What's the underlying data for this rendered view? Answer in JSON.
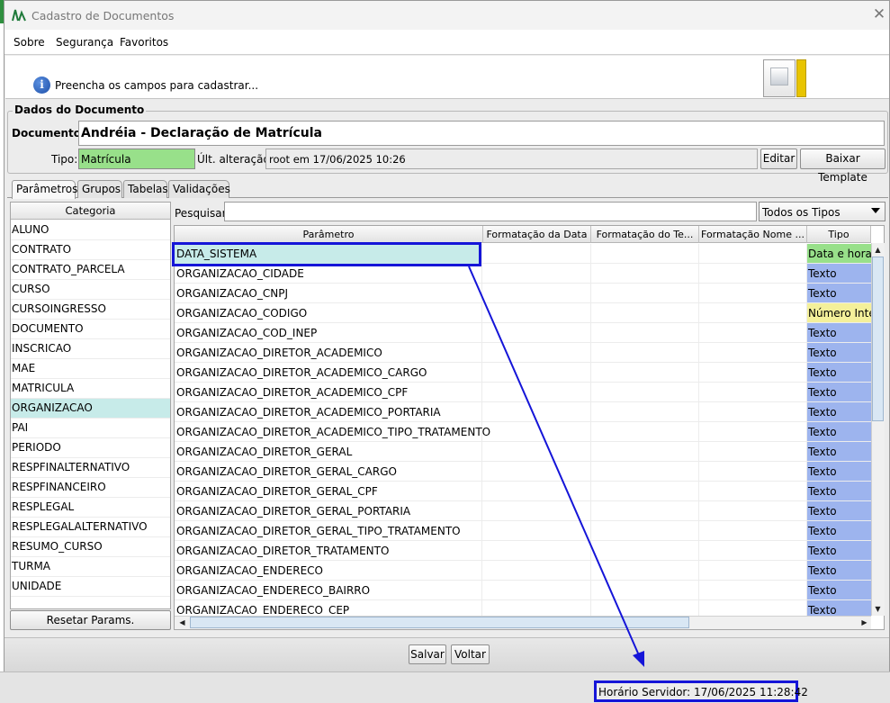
{
  "window": {
    "title": "Cadastro de Documentos",
    "close_glyph": "✕"
  },
  "menu": {
    "items": [
      "Sobre",
      "Segurança",
      "Favoritos"
    ]
  },
  "banner": {
    "message": "Preencha os campos para cadastrar..."
  },
  "document": {
    "group_title": "Dados do Documento",
    "doc_label": "Documento:",
    "doc_value": "Andréia - Declaração de Matrícula",
    "tipo_label": "Tipo:",
    "tipo_value": "Matrícula",
    "ult_label": "Últ. alteração:",
    "ult_value": "root em 17/06/2025 10:26",
    "edit_button": "Editar",
    "download_button": "Baixar Template"
  },
  "tabs": [
    "Parâmetros",
    "Grupos",
    "Tabelas",
    "Validações"
  ],
  "categories": {
    "header": "Categoria",
    "items": [
      "ALUNO",
      "CONTRATO",
      "CONTRATO_PARCELA",
      "CURSO",
      "CURSOINGRESSO",
      "DOCUMENTO",
      "INSCRICAO",
      "MAE",
      "MATRICULA",
      "ORGANIZACAO",
      "PAI",
      "PERIODO",
      "RESPFINALTERNATIVO",
      "RESPFINANCEIRO",
      "RESPLEGAL",
      "RESPLEGALALTERNATIVO",
      "RESUMO_CURSO",
      "TURMA",
      "UNIDADE"
    ],
    "selected": "ORGANIZACAO",
    "reset_button": "Resetar Params."
  },
  "search": {
    "label": "Pesquisar:",
    "value": "",
    "filter_value": "Todos os Tipos"
  },
  "grid": {
    "columns": [
      "Parâmetro",
      "Formatação da Data",
      "Formatação do Te...",
      "Formatação Nome ...",
      "Tipo"
    ],
    "rows": [
      {
        "param": "DATA_SISTEMA",
        "tipo": "Data e hora"
      },
      {
        "param": "ORGANIZACAO_CIDADE",
        "tipo": "Texto"
      },
      {
        "param": "ORGANIZACAO_CNPJ",
        "tipo": "Texto"
      },
      {
        "param": "ORGANIZACAO_CODIGO",
        "tipo": "Número Inteiro"
      },
      {
        "param": "ORGANIZACAO_COD_INEP",
        "tipo": "Texto"
      },
      {
        "param": "ORGANIZACAO_DIRETOR_ACADEMICO",
        "tipo": "Texto"
      },
      {
        "param": "ORGANIZACAO_DIRETOR_ACADEMICO_CARGO",
        "tipo": "Texto"
      },
      {
        "param": "ORGANIZACAO_DIRETOR_ACADEMICO_CPF",
        "tipo": "Texto"
      },
      {
        "param": "ORGANIZACAO_DIRETOR_ACADEMICO_PORTARIA",
        "tipo": "Texto"
      },
      {
        "param": "ORGANIZACAO_DIRETOR_ACADEMICO_TIPO_TRATAMENTO",
        "tipo": "Texto"
      },
      {
        "param": "ORGANIZACAO_DIRETOR_GERAL",
        "tipo": "Texto"
      },
      {
        "param": "ORGANIZACAO_DIRETOR_GERAL_CARGO",
        "tipo": "Texto"
      },
      {
        "param": "ORGANIZACAO_DIRETOR_GERAL_CPF",
        "tipo": "Texto"
      },
      {
        "param": "ORGANIZACAO_DIRETOR_GERAL_PORTARIA",
        "tipo": "Texto"
      },
      {
        "param": "ORGANIZACAO_DIRETOR_GERAL_TIPO_TRATAMENTO",
        "tipo": "Texto"
      },
      {
        "param": "ORGANIZACAO_DIRETOR_TRATAMENTO",
        "tipo": "Texto"
      },
      {
        "param": "ORGANIZACAO_ENDERECO",
        "tipo": "Texto"
      },
      {
        "param": "ORGANIZACAO_ENDERECO_BAIRRO",
        "tipo": "Texto"
      },
      {
        "param": "ORGANIZACAO_ENDERECO_CEP",
        "tipo": "Texto"
      }
    ]
  },
  "tipo_colors": {
    "Data e hora": "#98e08a",
    "Texto": "#9db4ee",
    "Número Inteiro": "#f4f09a"
  },
  "actions": {
    "save": "Salvar",
    "back": "Voltar"
  },
  "status": {
    "server_time": "Horário Servidor: 17/06/2025 11:28:42"
  },
  "icons": {
    "info": "info-icon",
    "app_logo": "app-logo-icon",
    "close": "close-icon",
    "dropdown": "chevron-down-icon"
  },
  "colors": {
    "annotation": "#1515d8",
    "selected_row": "#c7ebe9"
  }
}
